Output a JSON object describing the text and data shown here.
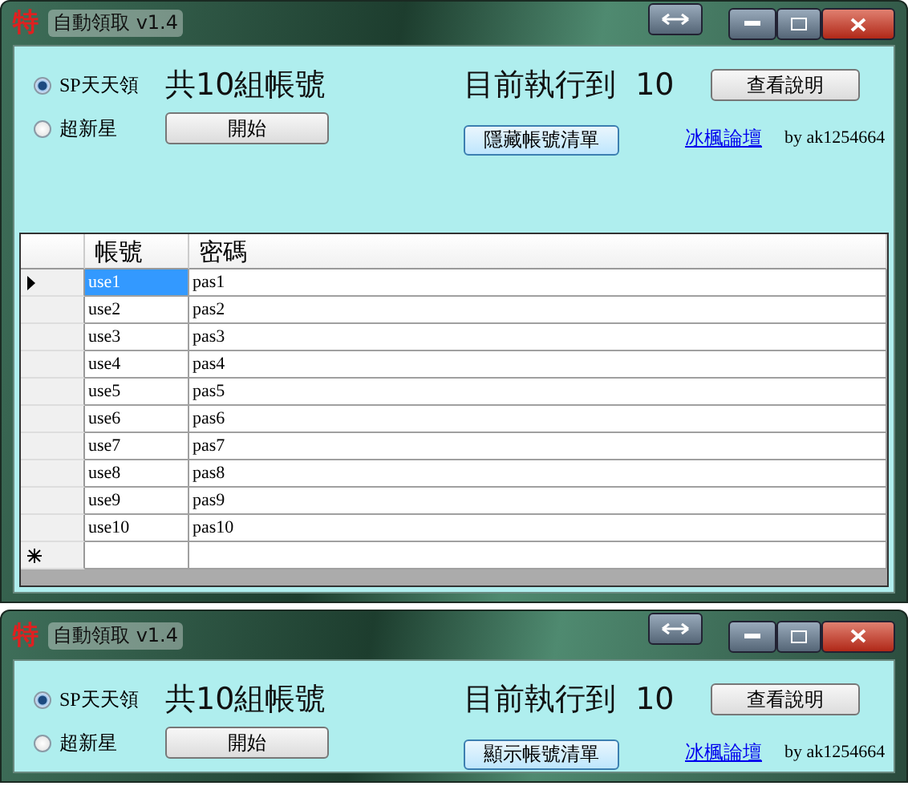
{
  "windows": [
    {
      "title_icon": "特",
      "title": "自動領取 v1.4",
      "options": [
        {
          "label": "SP天天領",
          "selected": true
        },
        {
          "label": "超新星",
          "selected": false
        }
      ],
      "account_count": "共10組帳號",
      "start_button": "開始",
      "progress_label": "目前執行到",
      "progress_value": "10",
      "help_button": "查看說明",
      "list_button": "隱藏帳號清單",
      "forum_link": "冰楓論壇",
      "author": "by ak1254664",
      "table": {
        "columns": [
          "帳號",
          "密碼"
        ],
        "rows": [
          {
            "cells": [
              "use1",
              "pas1"
            ],
            "current": true,
            "selected": true
          },
          {
            "cells": [
              "use2",
              "pas2"
            ],
            "current": false,
            "selected": false
          },
          {
            "cells": [
              "use3",
              "pas3"
            ],
            "current": false,
            "selected": false
          },
          {
            "cells": [
              "use4",
              "pas4"
            ],
            "current": false,
            "selected": false
          },
          {
            "cells": [
              "use5",
              "pas5"
            ],
            "current": false,
            "selected": false
          },
          {
            "cells": [
              "use6",
              "pas6"
            ],
            "current": false,
            "selected": false
          },
          {
            "cells": [
              "use7",
              "pas7"
            ],
            "current": false,
            "selected": false
          },
          {
            "cells": [
              "use8",
              "pas8"
            ],
            "current": false,
            "selected": false
          },
          {
            "cells": [
              "use9",
              "pas9"
            ],
            "current": false,
            "selected": false
          },
          {
            "cells": [
              "use10",
              "pas10"
            ],
            "current": false,
            "selected": false
          }
        ]
      }
    },
    {
      "title_icon": "特",
      "title": "自動領取 v1.4",
      "options": [
        {
          "label": "SP天天領",
          "selected": true
        },
        {
          "label": "超新星",
          "selected": false
        }
      ],
      "account_count": "共10組帳號",
      "start_button": "開始",
      "progress_label": "目前執行到",
      "progress_value": "10",
      "help_button": "查看說明",
      "list_button": "顯示帳號清單",
      "forum_link": "冰楓論壇",
      "author": "by ak1254664"
    }
  ]
}
